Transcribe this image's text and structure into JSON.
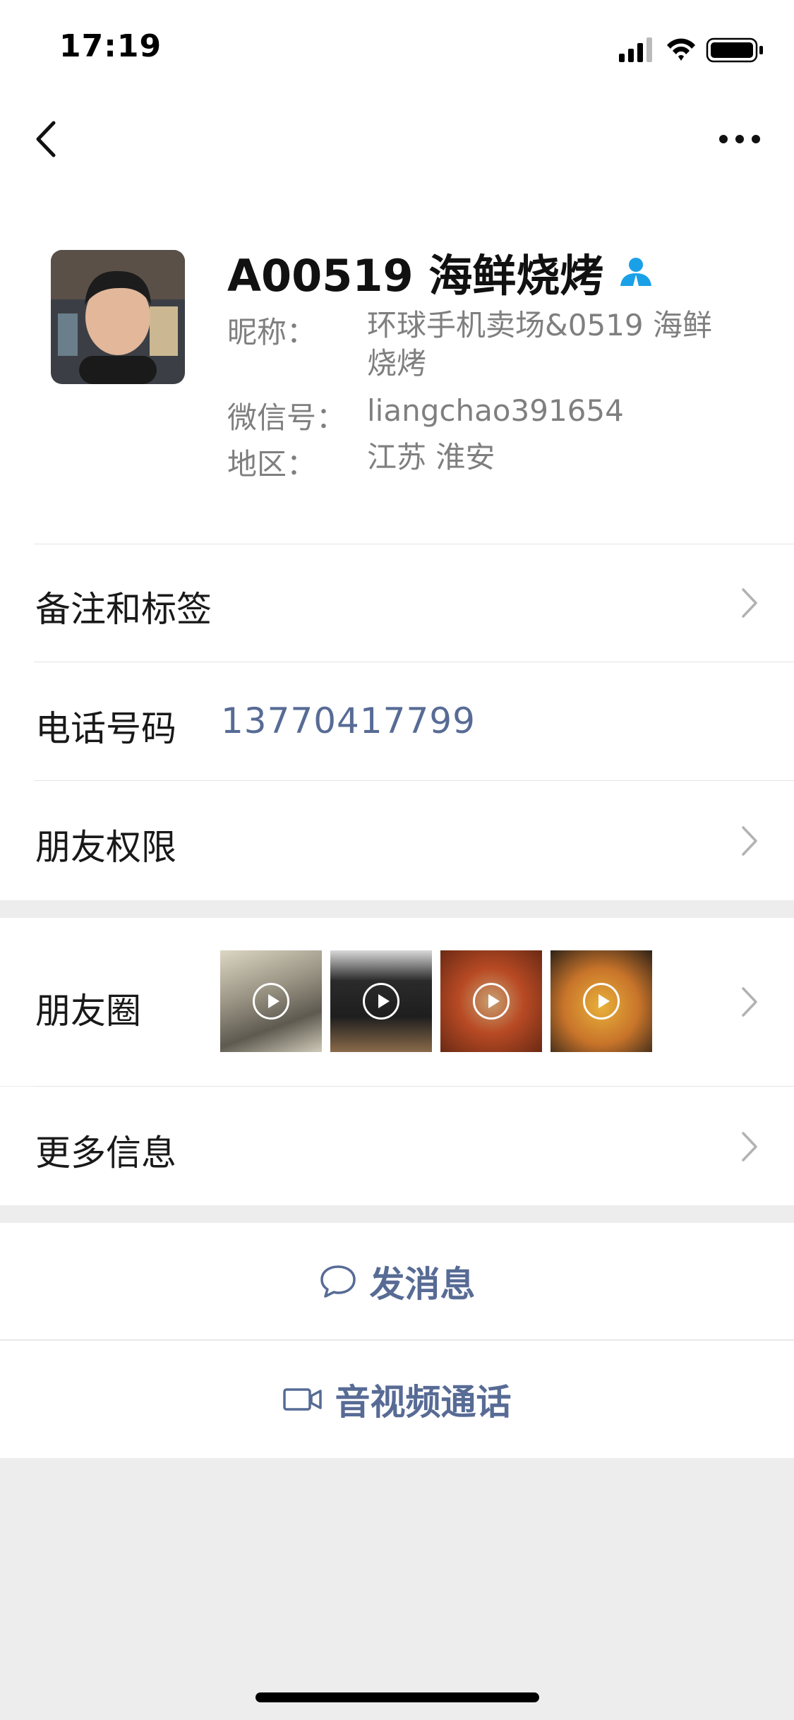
{
  "status_bar": {
    "time": "17:19"
  },
  "nav": {
    "back_icon": "chevron-left-icon",
    "more_icon": "more-dots-icon"
  },
  "profile": {
    "name": "A00519 海鲜烧烤",
    "verified_icon": "person-badge-icon",
    "nickname_label": "昵称：",
    "nickname": "环球手机卖场&0519 海鲜烧烤",
    "wechat_id_label": "微信号：",
    "wechat_id": "liangchao391654",
    "region_label": "地区：",
    "region": "江苏 淮安"
  },
  "rows": {
    "remark_tags": "备注和标签",
    "phone_label": "电话号码",
    "phone": "13770417799",
    "friend_permissions": "朋友权限",
    "moments": "朋友圈",
    "more_info": "更多信息"
  },
  "moments_thumbs": [
    {
      "name": "grill-skewers",
      "colors": [
        "#d9d4c4",
        "#6e6a5f"
      ],
      "video": true
    },
    {
      "name": "person-grilling",
      "colors": [
        "#2a2a2a",
        "#8a6a4a"
      ],
      "video": true
    },
    {
      "name": "grilled-fish",
      "colors": [
        "#b84a24",
        "#6b2a14"
      ],
      "video": true
    },
    {
      "name": "shrimp-dish",
      "colors": [
        "#d99a2a",
        "#3a2a1a"
      ],
      "video": true
    }
  ],
  "actions": {
    "message_icon": "chat-bubble-icon",
    "message": "发消息",
    "call_icon": "video-camera-icon",
    "call": "音视频通话"
  },
  "colors": {
    "link": "#576b95",
    "verified": "#1aa0e6",
    "background": "#ededed"
  }
}
